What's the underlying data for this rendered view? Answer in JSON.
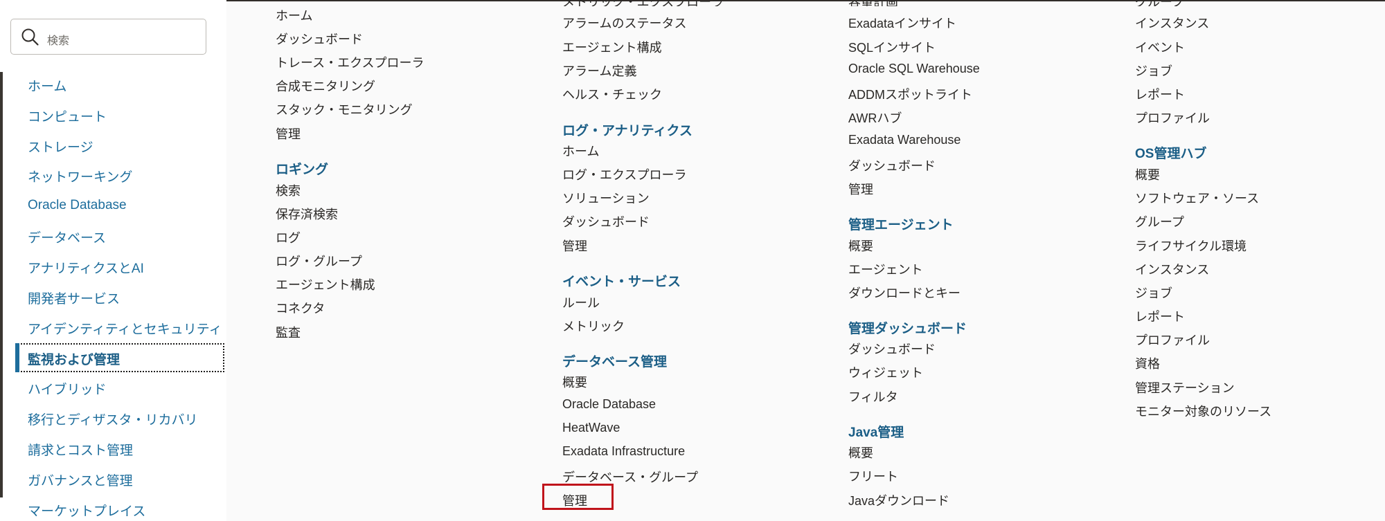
{
  "search": {
    "placeholder": "検索"
  },
  "sidebar": {
    "items": [
      {
        "label": "ホーム"
      },
      {
        "label": "コンピュート"
      },
      {
        "label": "ストレージ"
      },
      {
        "label": "ネットワーキング"
      },
      {
        "label": "Oracle Database"
      },
      {
        "label": "データベース"
      },
      {
        "label": "アナリティクスとAI"
      },
      {
        "label": "開発者サービス"
      },
      {
        "label": "アイデンティティとセキュリティ"
      },
      {
        "label": "監視および管理",
        "active": true
      },
      {
        "label": "ハイブリッド"
      },
      {
        "label": "移行とディザスタ・リカバリ"
      },
      {
        "label": "請求とコスト管理"
      },
      {
        "label": "ガバナンスと管理"
      },
      {
        "label": "マーケットプレイス"
      }
    ]
  },
  "menu": {
    "col1": {
      "apm_links": [
        "ホーム",
        "ダッシュボード",
        "トレース・エクスプローラ",
        "合成モニタリング",
        "スタック・モニタリング",
        "管理"
      ],
      "logging": {
        "heading": "ロギング",
        "links": [
          "検索",
          "保存済検索",
          "ログ",
          "ログ・グループ",
          "エージェント構成",
          "コネクタ",
          "監査"
        ]
      }
    },
    "col2": {
      "partial_top": "メトリック・エクスプローラ",
      "monitoring_links": [
        "アラームのステータス",
        "エージェント構成",
        "アラーム定義",
        "ヘルス・チェック"
      ],
      "log_analytics": {
        "heading": "ログ・アナリティクス",
        "links": [
          "ホーム",
          "ログ・エクスプローラ",
          "ソリューション",
          "ダッシュボード",
          "管理"
        ]
      },
      "events": {
        "heading": "イベント・サービス",
        "links": [
          "ルール",
          "メトリック"
        ]
      },
      "db_management": {
        "heading": "データベース管理",
        "links": [
          "概要",
          "Oracle Database",
          "HeatWave",
          "Exadata Infrastructure",
          "データベース・グループ",
          "管理"
        ]
      }
    },
    "col3": {
      "partial_top": "容量計画",
      "ops_insights_links": [
        "Exadataインサイト",
        "SQLインサイト",
        "Oracle SQL Warehouse",
        "ADDMスポットライト",
        "AWRハブ",
        "Exadata Warehouse",
        "ダッシュボード",
        "管理"
      ],
      "mgmt_agent": {
        "heading": "管理エージェント",
        "links": [
          "概要",
          "エージェント",
          "ダウンロードとキー"
        ]
      },
      "mgmt_dashboard": {
        "heading": "管理ダッシュボード",
        "links": [
          "ダッシュボード",
          "ウィジェット",
          "フィルタ"
        ]
      },
      "java_mgmt": {
        "heading": "Java管理",
        "links": [
          "概要",
          "フリート",
          "Javaダウンロード"
        ]
      }
    },
    "col4": {
      "partial_top": "グループ",
      "fleet_links": [
        "インスタンス",
        "イベント",
        "ジョブ",
        "レポート",
        "プロファイル"
      ],
      "os_mgmt_hub": {
        "heading": "OS管理ハブ",
        "links": [
          "概要",
          "ソフトウェア・ソース",
          "グループ",
          "ライフサイクル環境",
          "インスタンス",
          "ジョブ",
          "レポート",
          "プロファイル",
          "資格",
          "管理ステーション",
          "モニター対象のリソース"
        ]
      }
    }
  },
  "colors": {
    "accent": "#1b5e86",
    "link": "#1d6d9c",
    "highlight": "#c0141b"
  }
}
